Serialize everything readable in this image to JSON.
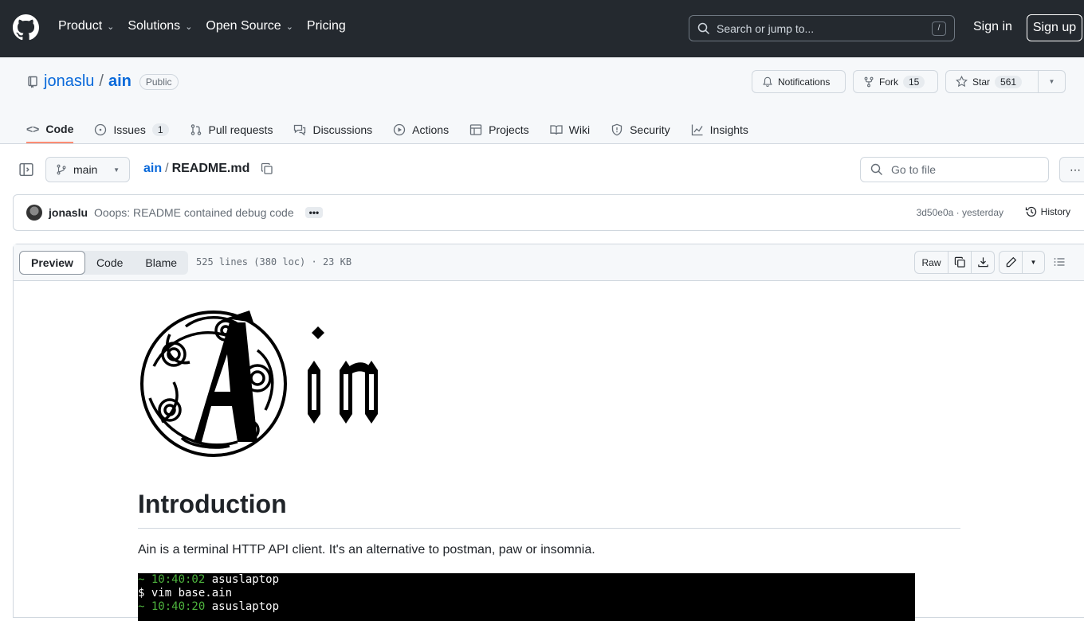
{
  "topnav": {
    "items": [
      {
        "label": "Product",
        "chevron": true
      },
      {
        "label": "Solutions",
        "chevron": true
      },
      {
        "label": "Open Source",
        "chevron": true
      },
      {
        "label": "Pricing",
        "chevron": false
      }
    ],
    "search_placeholder": "Search or jump to...",
    "search_shortcut": "/",
    "signin": "Sign in",
    "signup": "Sign up"
  },
  "repo": {
    "owner": "jonaslu",
    "separator": "/",
    "name": "ain",
    "visibility": "Public",
    "notifications_label": "Notifications",
    "fork_label": "Fork",
    "fork_count": "15",
    "star_label": "Star",
    "star_count": "561"
  },
  "tabs": [
    {
      "label": "Code",
      "icon": "code-icon",
      "active": true
    },
    {
      "label": "Issues",
      "icon": "issue-icon",
      "count": "1"
    },
    {
      "label": "Pull requests",
      "icon": "pull-request-icon"
    },
    {
      "label": "Discussions",
      "icon": "discussion-icon"
    },
    {
      "label": "Actions",
      "icon": "play-icon"
    },
    {
      "label": "Projects",
      "icon": "table-icon"
    },
    {
      "label": "Wiki",
      "icon": "book-icon"
    },
    {
      "label": "Security",
      "icon": "shield-icon"
    },
    {
      "label": "Insights",
      "icon": "graph-icon"
    }
  ],
  "file": {
    "branch": "main",
    "repo_link": "ain",
    "path_sep": "/",
    "filename": "README.md",
    "goto_placeholder": "Go to file"
  },
  "commit": {
    "author": "jonaslu",
    "message": "Ooops: README contained debug code",
    "sha": "3d50e0a",
    "time": "yesterday",
    "meta_sep": " · ",
    "history": "History"
  },
  "viewer": {
    "modes": [
      "Preview",
      "Code",
      "Blame"
    ],
    "active_mode": "Preview",
    "info": "525 lines (380 loc) · 23 KB",
    "raw": "Raw"
  },
  "readme": {
    "heading": "Introduction",
    "intro": "Ain is a terminal HTTP API client. It's an alternative to postman, paw or insomnia.",
    "terminal": [
      {
        "prefix": "~ ",
        "time": "10:40:02",
        "rest": " asuslaptop"
      },
      {
        "prefix": "",
        "time": "",
        "rest": "$ vim base.ain"
      },
      {
        "prefix": "~ ",
        "time": "10:40:20",
        "rest": " asuslaptop"
      }
    ]
  }
}
